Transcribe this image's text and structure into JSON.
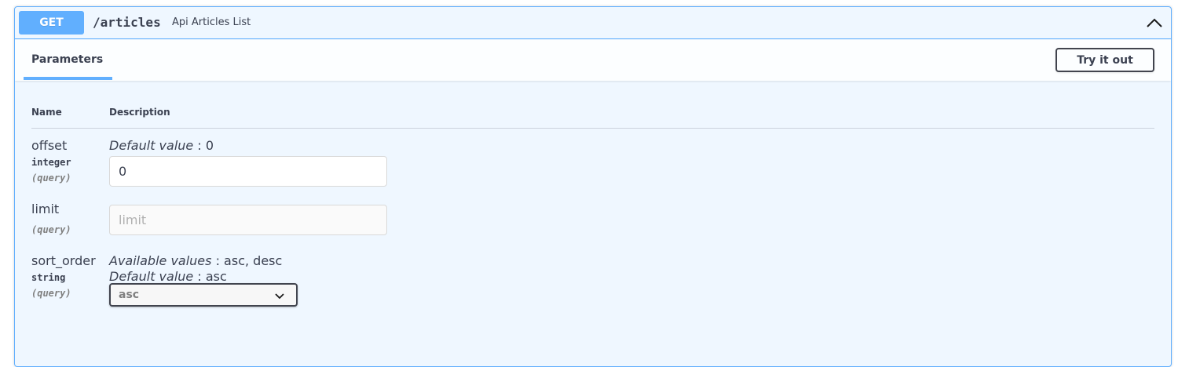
{
  "operation": {
    "method": "GET",
    "path": "/articles",
    "summary": "Api Articles List"
  },
  "tabs": {
    "parameters_label": "Parameters",
    "try_it_out_label": "Try it out"
  },
  "table": {
    "col_name": "Name",
    "col_description": "Description"
  },
  "params": [
    {
      "name": "offset",
      "type": "integer",
      "in": "(query)",
      "default_label": "Default value",
      "default_value": ": 0",
      "input_value": "0"
    },
    {
      "name": "limit",
      "in": "(query)",
      "placeholder": "limit"
    },
    {
      "name": "sort_order",
      "type": "string",
      "in": "(query)",
      "available_label": "Available values",
      "available_values": ": asc, desc",
      "default_label": "Default value",
      "default_value": ": asc",
      "selected": "asc"
    }
  ],
  "colors": {
    "get_accent": "#61affe",
    "text": "#3b4151"
  },
  "icons": {
    "collapse": "chevron-up-icon",
    "select_caret": "chevron-down-icon"
  }
}
